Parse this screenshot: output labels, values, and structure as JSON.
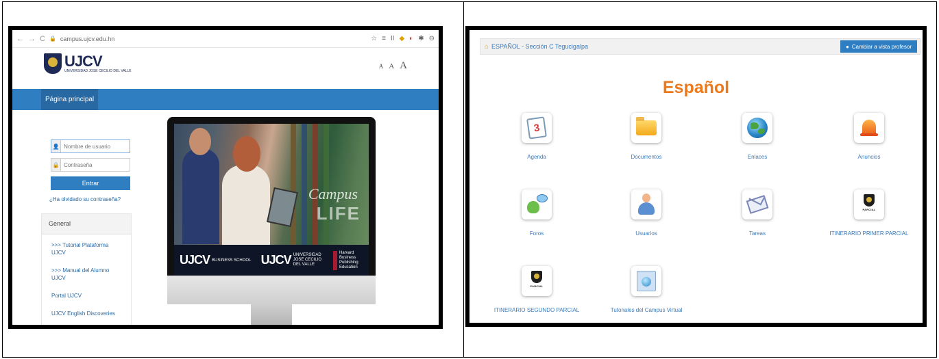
{
  "left_screenshot": {
    "browser": {
      "url": "campus.ujcv.edu.hn",
      "nav_back": "←",
      "nav_forward": "→",
      "nav_reload": "C",
      "lock_icon": "🔒",
      "ext_icons": [
        "☆",
        "≡",
        "II",
        "◆",
        "◐",
        "✱",
        "⊖"
      ]
    },
    "logo": {
      "word": "UJCV",
      "sub": "UNIVERSIDAD JOSE CECILIO DEL VALLE"
    },
    "font_size_controls": [
      "A",
      "A",
      "A"
    ],
    "nav": {
      "home": "Página principal"
    },
    "login": {
      "username_placeholder": "Nombre de usuario",
      "password_placeholder": "Contraseña",
      "user_icon": "👤",
      "password_icon": "🔒",
      "enter_label": "Entrar",
      "forgot_label": "¿Ha olvidado su contraseña?"
    },
    "general_block": {
      "title": "General",
      "links": [
        ">>> Tutorial Plataforma UJCV",
        ">>> Manual del Alumno UJCV",
        "Portal UJCV",
        "UJCV English Discoveries"
      ]
    },
    "monitor": {
      "campus_text": "Campus",
      "life_text": "LIFE",
      "brand_left": "UJCV",
      "brand_left_sub": "BUSINESS SCHOOL",
      "brand_mid": "UJCV",
      "brand_mid_sub": "UNIVERSIDAD JOSE CECILIO DEL VALLE",
      "harvard": "Harvard Business Publishing Education",
      "apple_icon": ""
    }
  },
  "right_screenshot": {
    "breadcrumb": "ESPAÑOL - Sección C Tegucigalpa",
    "home_icon": "⌂",
    "teacher_view_button": "Cambiar a vista profesor",
    "teacher_view_icon": "●",
    "course_title": "Español",
    "tools": [
      {
        "label": "Agenda",
        "icon": "calendar-icon",
        "badge": "3"
      },
      {
        "label": "Documentos",
        "icon": "folder-icon"
      },
      {
        "label": "Enlaces",
        "icon": "globe-icon"
      },
      {
        "label": "Anuncios",
        "icon": "bell-icon"
      },
      {
        "label": "Foros",
        "icon": "forum-icon"
      },
      {
        "label": "Usuarios",
        "icon": "user-icon"
      },
      {
        "label": "Tareas",
        "icon": "envelope-icon"
      },
      {
        "label": "ITINERARIO PRIMER PARCIAL",
        "icon": "parcial-emblem-icon",
        "emblem_text": "PARCIAL"
      },
      {
        "label": "ITINERARIO SEGUNDO PARCIAL",
        "icon": "parcial-emblem-icon",
        "emblem_text": "PARCIAL"
      },
      {
        "label": "Tutoriales del Campus Virtual",
        "icon": "tutorial-icon"
      }
    ]
  }
}
